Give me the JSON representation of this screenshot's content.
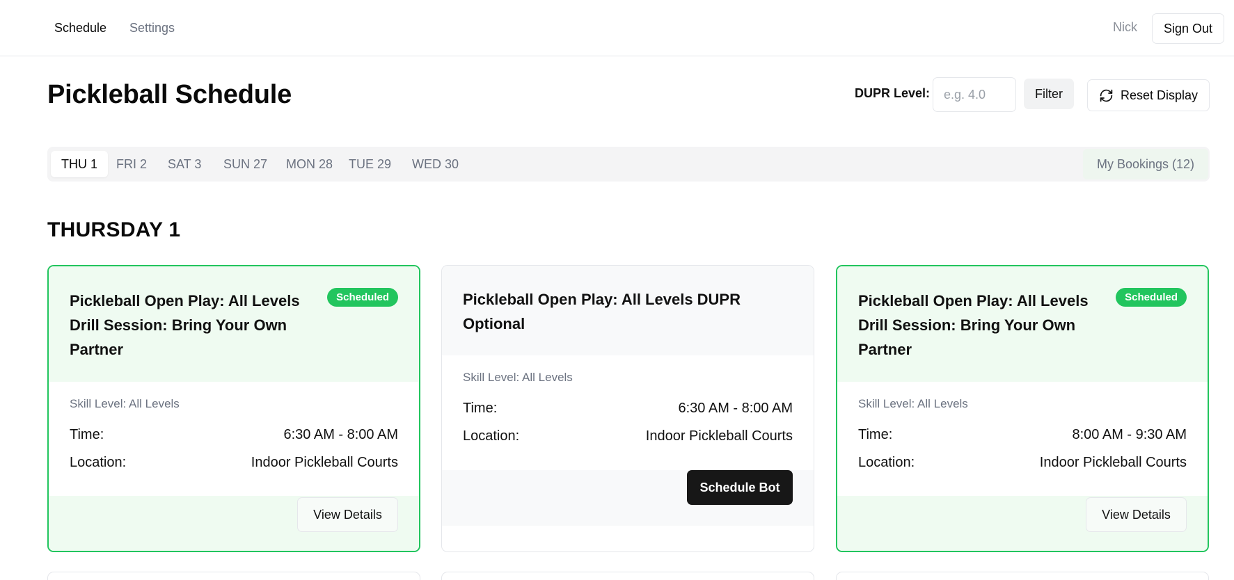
{
  "nav": {
    "links": [
      "Schedule",
      "Settings"
    ],
    "user": "Nick",
    "sign_out": "Sign Out"
  },
  "header": {
    "title": "Pickleball Schedule",
    "dupr_label": "DUPR Level:",
    "dupr_placeholder": "e.g. 4.0",
    "filter_label": "Filter",
    "reset_label": "Reset Display"
  },
  "tabs": {
    "days": [
      "THU 1",
      "FRI 2",
      "SAT 3",
      "SUN 27",
      "MON 28",
      "TUE 29",
      "WED 30"
    ],
    "active_index": 0,
    "bookings": "My Bookings (12)"
  },
  "day_heading": "THURSDAY 1",
  "cards": [
    {
      "title": "Pickleball Open Play: All Levels Drill Session: Bring Your Own Partner",
      "status": "Scheduled",
      "skill": "Skill Level: All Levels",
      "time_label": "Time:",
      "time": "6:30 AM - 8:00 AM",
      "location_label": "Location:",
      "location": "Indoor Pickleball Courts",
      "action": "View Details"
    },
    {
      "title": "Pickleball Open Play: All Levels DUPR Optional",
      "status": "",
      "skill": "Skill Level: All Levels",
      "time_label": "Time:",
      "time": "6:30 AM - 8:00 AM",
      "location_label": "Location:",
      "location": "Indoor Pickleball Courts",
      "action": "Schedule Bot"
    },
    {
      "title": "Pickleball Open Play: All Levels Drill Session: Bring Your Own Partner",
      "status": "Scheduled",
      "skill": "Skill Level: All Levels",
      "time_label": "Time:",
      "time": "8:00 AM - 9:30 AM",
      "location_label": "Location:",
      "location": "Indoor Pickleball Courts",
      "action": "View Details"
    }
  ],
  "colors": {
    "accent_green": "#22c55e",
    "scheduled_bg": "#effbf1",
    "primary_dark": "#171717"
  }
}
